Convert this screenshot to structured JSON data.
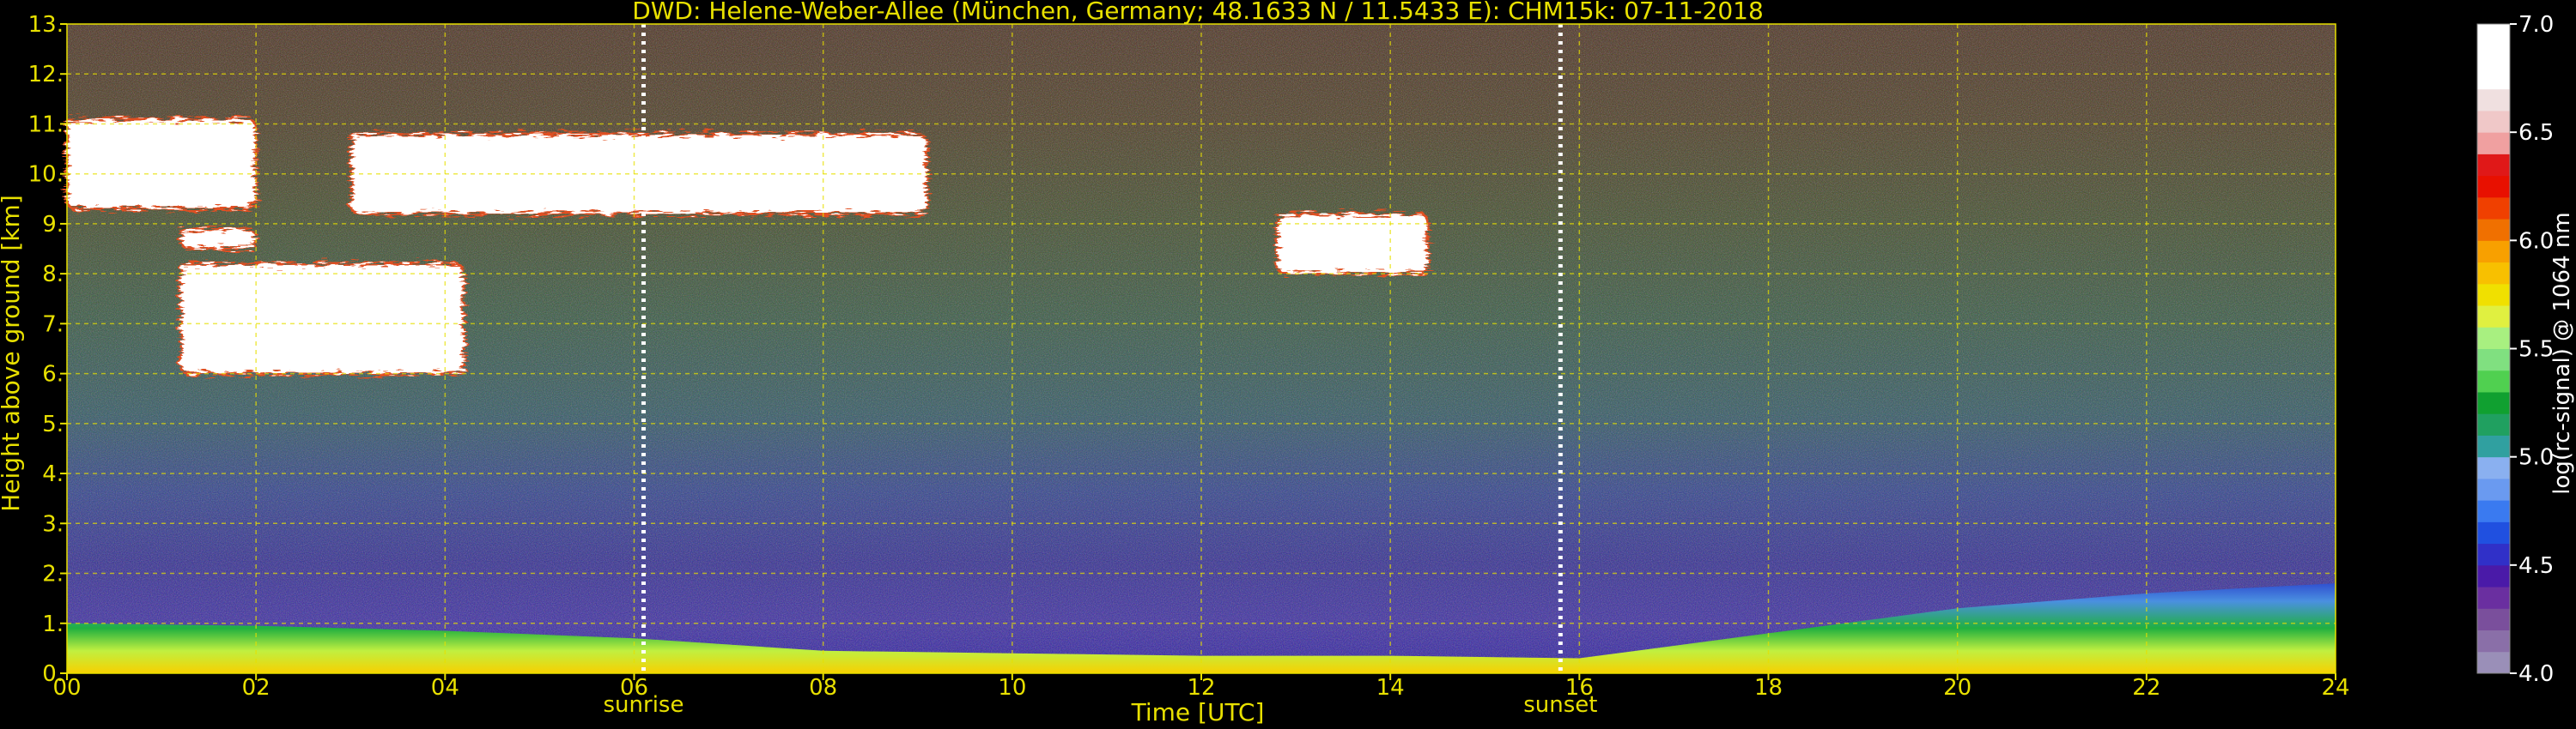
{
  "chart_data": {
    "type": "heatmap",
    "title": "DWD: Helene-Weber-Allee (München, Germany; 48.1633 N / 11.5433 E):    CHM15k: 07-11-2018",
    "xlabel": "Time [UTC]",
    "ylabel": "Height above ground [km]",
    "xlim": [
      0,
      24
    ],
    "ylim": [
      0,
      13
    ],
    "x_ticks": [
      "00",
      "02",
      "04",
      "06",
      "08",
      "10",
      "12",
      "14",
      "16",
      "18",
      "20",
      "22",
      "24"
    ],
    "y_ticks": [
      "0.",
      "1.",
      "2.",
      "3.",
      "4.",
      "5.",
      "6.",
      "7.",
      "8.",
      "9.",
      "10.",
      "11.",
      "12.",
      "13."
    ],
    "grid": true,
    "events": [
      {
        "label": "sunrise",
        "time": 6.1
      },
      {
        "label": "sunset",
        "time": 15.8
      }
    ],
    "colorbar": {
      "label": "log(rc-signal) @ 1064 nm",
      "range": [
        4.0,
        7.0
      ],
      "ticks": [
        "4.0",
        "4.5",
        "5.0",
        "5.5",
        "6.0",
        "6.5",
        "7.0"
      ],
      "colors": [
        "#9a8fb8",
        "#8a6fa8",
        "#7a4f9c",
        "#6a2fa0",
        "#4a1aa8",
        "#3030c8",
        "#2050e0",
        "#3a7af0",
        "#6a9af0",
        "#8ab0f0",
        "#30a0a0",
        "#20a060",
        "#10a030",
        "#50d050",
        "#80e080",
        "#a8f080",
        "#e0f040",
        "#f0e000",
        "#f8c000",
        "#f8a000",
        "#f07000",
        "#f04000",
        "#e81000",
        "#e01818",
        "#f0a0a0",
        "#f0c8c8",
        "#f0e0e0",
        "#ffffff",
        "#ffffff",
        "#ffffff"
      ]
    },
    "cloud_layers": [
      {
        "start": 0.0,
        "end": 2.0,
        "bottom": 9.3,
        "top": 11.1
      },
      {
        "start": 1.2,
        "end": 2.0,
        "bottom": 8.5,
        "top": 8.9
      },
      {
        "start": 1.2,
        "end": 4.2,
        "bottom": 6.0,
        "top": 8.2
      },
      {
        "start": 3.0,
        "end": 9.1,
        "bottom": 9.2,
        "top": 10.8
      },
      {
        "start": 12.8,
        "end": 14.4,
        "bottom": 8.0,
        "top": 9.2
      }
    ],
    "boundary_layer": [
      {
        "time": 0,
        "top": 1.0
      },
      {
        "time": 2,
        "top": 0.95
      },
      {
        "time": 4,
        "top": 0.85
      },
      {
        "time": 6,
        "top": 0.7
      },
      {
        "time": 8,
        "top": 0.45
      },
      {
        "time": 10,
        "top": 0.4
      },
      {
        "time": 12,
        "top": 0.35
      },
      {
        "time": 14,
        "top": 0.35
      },
      {
        "time": 16,
        "top": 0.3
      },
      {
        "time": 18,
        "top": 0.8
      },
      {
        "time": 20,
        "top": 1.3
      },
      {
        "time": 22,
        "top": 1.6
      },
      {
        "time": 24,
        "top": 1.8
      }
    ]
  }
}
